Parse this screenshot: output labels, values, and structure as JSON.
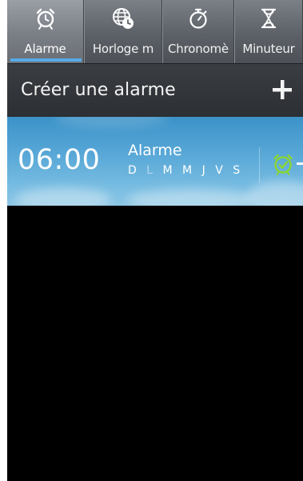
{
  "tabs": [
    {
      "label": "Alarme",
      "icon": "alarm-clock-icon",
      "active": true
    },
    {
      "label": "Horloge m",
      "icon": "world-clock-icon",
      "active": false
    },
    {
      "label": "Chronomè",
      "icon": "stopwatch-icon",
      "active": false
    },
    {
      "label": "Minuteur",
      "icon": "hourglass-icon",
      "active": false
    }
  ],
  "create_alarm": {
    "label": "Créer une alarme",
    "button_icon": "plus-icon"
  },
  "alarms": [
    {
      "time": "06:00",
      "name": "Alarme",
      "days": [
        {
          "letter": "D",
          "active": true
        },
        {
          "letter": "L",
          "active": false
        },
        {
          "letter": "M",
          "active": true
        },
        {
          "letter": "M",
          "active": true
        },
        {
          "letter": "J",
          "active": true
        },
        {
          "letter": "V",
          "active": true
        },
        {
          "letter": "S",
          "active": true
        }
      ],
      "enabled": true,
      "toggle_icon": "alarm-clock-icon"
    }
  ],
  "colors": {
    "tab_underline": "#56a9e8",
    "alarm_icon_green": "#8bd62e",
    "alarm_background": "#5aa9d8"
  }
}
